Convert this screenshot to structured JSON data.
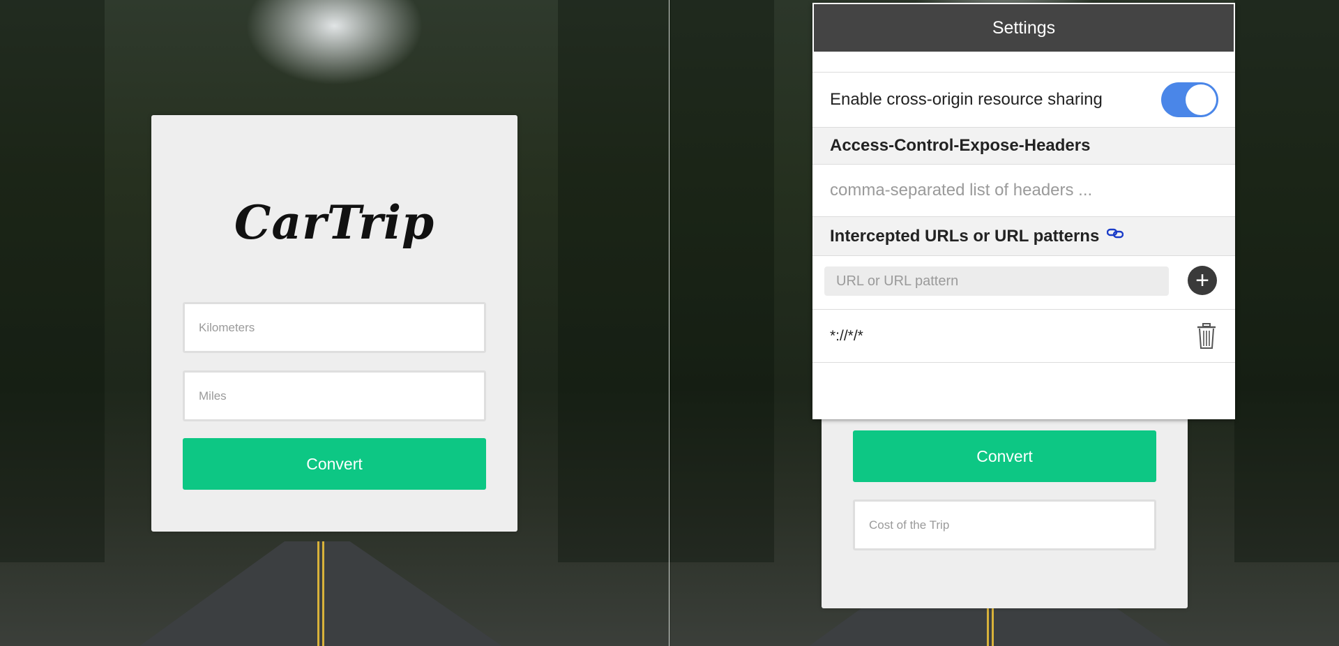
{
  "left_app": {
    "logo": "CarTrip",
    "kilometers_placeholder": "Kilometers",
    "miles_placeholder": "Miles",
    "convert_label": "Convert"
  },
  "right_app": {
    "convert_label": "Convert",
    "cost_placeholder": "Cost of the Trip"
  },
  "settings": {
    "title": "Settings",
    "cors_label": "Enable cross-origin resource sharing",
    "cors_enabled": true,
    "expose_headers_title": "Access-Control-Expose-Headers",
    "expose_headers_placeholder": "comma-separated list of headers ...",
    "intercepted_title": "Intercepted URLs or URL patterns",
    "url_input_placeholder": "URL or URL pattern",
    "patterns": [
      "*://*/*"
    ]
  },
  "colors": {
    "accent_green": "#0dc784",
    "toggle_blue": "#4a86e8",
    "header_dark": "#444444",
    "link_icon_blue": "#1a3cc8"
  },
  "icons": [
    "link-icon",
    "plus-icon",
    "trash-icon"
  ]
}
